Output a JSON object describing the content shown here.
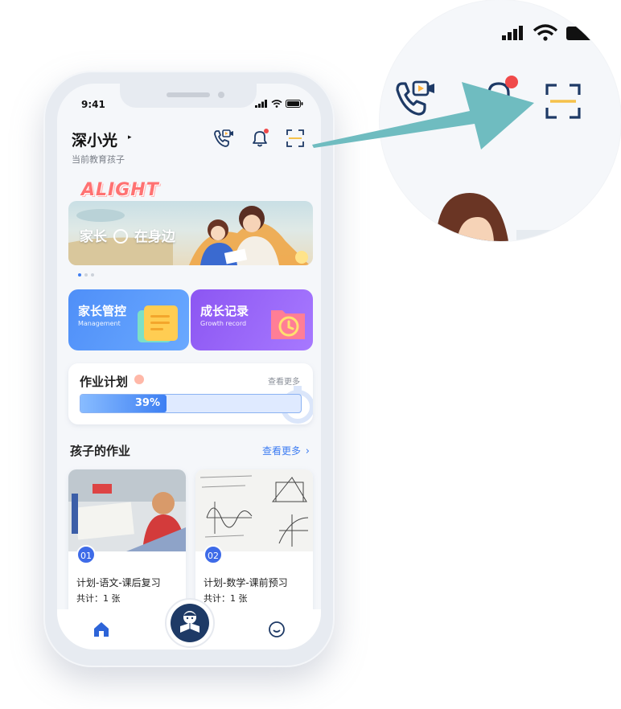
{
  "status_bar": {
    "time": "9:41"
  },
  "header": {
    "child_name": "深小光",
    "caret": "▸",
    "subtitle": "当前教育孩子",
    "icons": [
      "video-call-icon",
      "bell-icon",
      "scan-icon"
    ]
  },
  "banner": {
    "brand": "ALIGHT",
    "text_a": "家长",
    "text_b": "在身边",
    "slide_count": 3,
    "active_slide": 1
  },
  "cards": [
    {
      "title": "家长管控",
      "subtitle": "Management"
    },
    {
      "title": "成长记录",
      "subtitle": "Growth record"
    }
  ],
  "plan": {
    "title": "作业计划",
    "more": "查看更多",
    "progress_label": "39%",
    "progress": 0.39
  },
  "homework": {
    "title": "孩子的作业",
    "more": "查看更多",
    "items": [
      {
        "badge": "01",
        "title": "计划-语文-课后复习",
        "count": "共计：1 张"
      },
      {
        "badge": "02",
        "title": "计划-数学-课前预习",
        "count": "共计：1 张"
      }
    ]
  },
  "tabbar": {
    "items": [
      "home-icon",
      "reading-icon",
      "profile-icon"
    ]
  },
  "colors": {
    "primary": "#3e7df2",
    "coral": "#ff7272",
    "purple": "#8c56f2",
    "arrow": "#6fbcc0"
  }
}
